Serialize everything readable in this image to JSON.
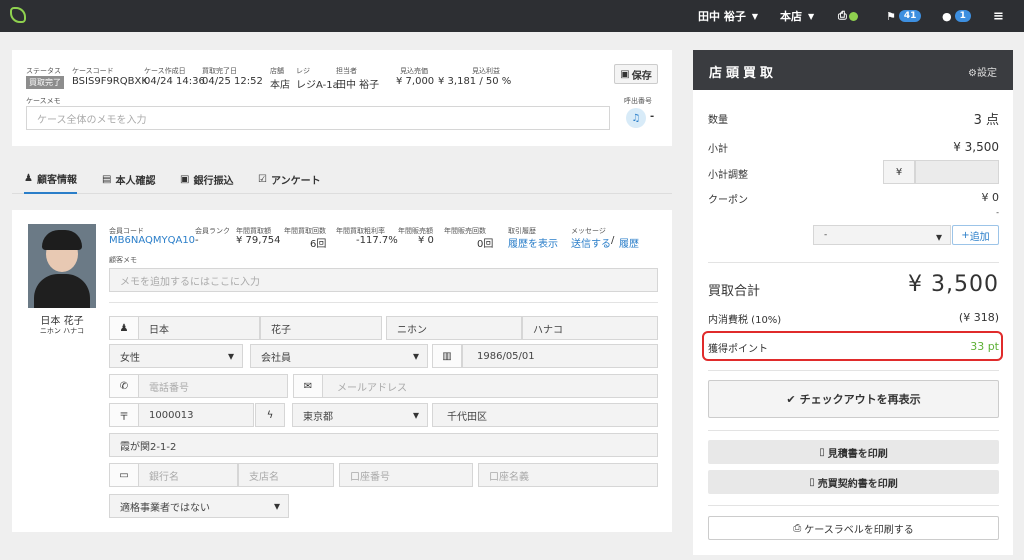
{
  "topbar": {
    "user": "田中 裕子",
    "store": "本店",
    "flag_count": "41",
    "chat_count": "1"
  },
  "case": {
    "status_label": "ステータス",
    "status": "買取完了",
    "code_label": "ケースコード",
    "code": "BSIS9F9RQBXK",
    "created_label": "ケース作成日",
    "created": "04/24 14:36",
    "done_label": "買取完了日",
    "done": "04/25 12:52",
    "store_label": "店舗",
    "store": "本店",
    "register_label": "レジ",
    "register": "レジA-1a",
    "staff_label": "担当者",
    "staff": "田中 裕子",
    "est_sales_label": "見込売価",
    "est_sales": "¥ 7,000",
    "est_profit_label": "見込利益",
    "est_profit": "¥ 3,181 / 50 %",
    "save": "保存",
    "memo_label": "ケースメモ",
    "memo_placeholder": "ケース全体のメモを入力",
    "call_label": "呼出番号",
    "call_value": "-"
  },
  "tabs": [
    "顧客情報",
    "本人確認",
    "銀行振込",
    "アンケート"
  ],
  "customer": {
    "name": "日本 花子",
    "kana": "ニホン ハナコ",
    "member_code_label": "会員コード",
    "member_code": "MB6NAQMYQA10",
    "rank_label": "会員ランク",
    "rank": "-",
    "annual_buy_label": "年間買取額",
    "annual_buy": "¥ 79,754",
    "annual_count_label": "年間買取回数",
    "annual_count": "6回",
    "gross_label": "年間買取粗利率",
    "gross": "-117.7%",
    "sales_label": "年間販売額",
    "sales": "¥ 0",
    "sales_count_label": "年間販売回数",
    "sales_count": "0回",
    "history_label": "取引履歴",
    "history_link": "履歴を表示",
    "message_label": "メッセージ",
    "send_link": "送信する",
    "slash": "/",
    "msg_history_link": "履歴",
    "memo_label": "顧客メモ",
    "memo_placeholder": "メモを追加するにはここに入力",
    "last_name": "日本",
    "first_name": "花子",
    "last_kana": "ニホン",
    "first_kana": "ハナコ",
    "gender": "女性",
    "member_type": "会社員",
    "birthday": "1986/05/01",
    "phone_placeholder": "電話番号",
    "email_placeholder": "メールアドレス",
    "zip": "1000013",
    "prefecture": "東京都",
    "city": "千代田区",
    "address": "霞が関2-1-2",
    "bank_placeholder": "銀行名",
    "branch_placeholder": "支店名",
    "account_placeholder": "口座番号",
    "holder_placeholder": "口座名義",
    "invoice": "適格事業者ではない"
  },
  "summary": {
    "title": "店頭買取",
    "settings": "設定",
    "qty_label": "数量",
    "qty": "3 点",
    "subtotal_label": "小計",
    "subtotal": "¥ 3,500",
    "adjust_label": "小計調整",
    "yen": "¥",
    "coupon_label": "クーポン",
    "coupon": "¥ 0",
    "coupon_dash": "-",
    "coupon_select": "-",
    "add": "追加",
    "total_label": "買取合計",
    "total": "¥ 3,500",
    "tax_label": "内消費税 (10%)",
    "tax": "(¥ 318)",
    "points_label": "獲得ポイント",
    "points": "33 pt",
    "checkout": "チェックアウトを再表示",
    "print_estimate": "見積書を印刷",
    "print_contract": "売買契約書を印刷",
    "print_label": "ケースラベルを印刷する"
  },
  "colors": {
    "accent": "#2a7ec9",
    "status_badge": "#8d8d8d",
    "points": "#5db035",
    "highlight": "#e02b2b",
    "header_dark": "#3a3c40"
  }
}
